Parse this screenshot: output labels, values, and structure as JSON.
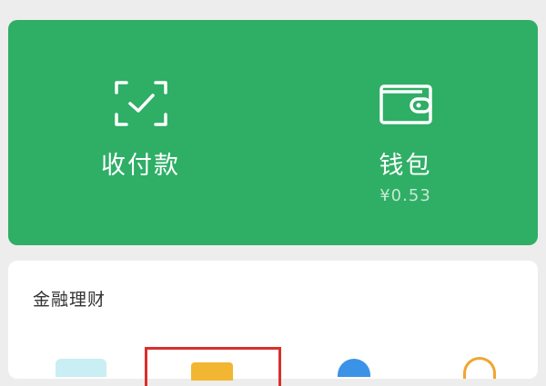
{
  "payments": {
    "collect": {
      "label": "收付款",
      "icon": "scan-check-icon"
    },
    "wallet": {
      "label": "钱包",
      "balance": "¥0.53",
      "icon": "wallet-icon"
    }
  },
  "finance": {
    "title": "金融理财",
    "items": [
      {
        "icon": "card-icon"
      },
      {
        "icon": "wealth-icon"
      },
      {
        "icon": "fund-icon"
      },
      {
        "icon": "coin-icon"
      }
    ]
  },
  "colors": {
    "accent": "#2fae66",
    "highlight": "#d9302c"
  }
}
